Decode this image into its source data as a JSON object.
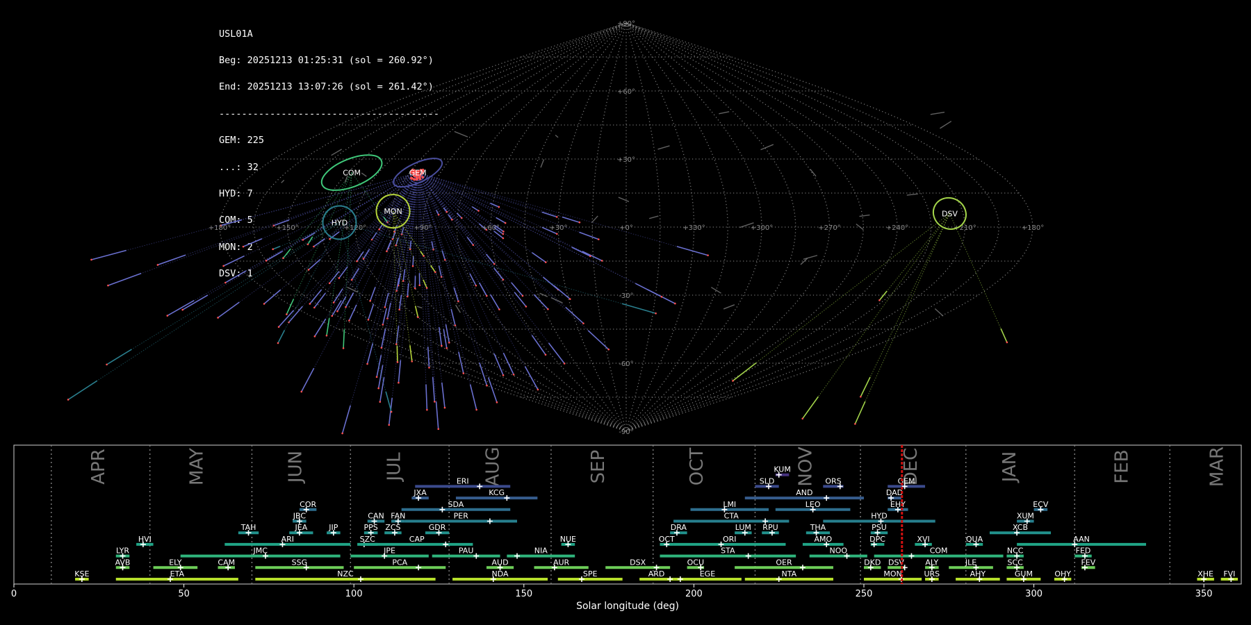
{
  "info_panel": {
    "station": "USL01A",
    "begin": "Beg: 20251213 01:25:31 (sol = 260.92°)",
    "end": "End: 20251213 13:07:26 (sol = 261.42°)",
    "separator": "---------------------------------------",
    "counts": [
      {
        "code": "GEM",
        "text": "GEM: 225"
      },
      {
        "code": "...",
        "text": "...: 32"
      },
      {
        "code": "HYD",
        "text": "HYD: 7"
      },
      {
        "code": "COM",
        "text": "COM: 5"
      },
      {
        "code": "MON",
        "text": "MON: 2"
      },
      {
        "code": "DSV",
        "text": "DSV: 1"
      }
    ]
  },
  "chart_data": [
    {
      "type": "scatter",
      "projection": "sinusoidal (all-sky, ecliptic)",
      "lon_tick_labels": [
        "+180°",
        "+150°",
        "+120°",
        "+90°",
        "+60°",
        "+30°",
        "+0°",
        "+330°",
        "+300°",
        "+270°",
        "+240°",
        "+210°",
        "+180°"
      ],
      "lat_tick_labels": [
        "+90°",
        "+60°",
        "+30°",
        "-30°",
        "-60°",
        "-90°"
      ],
      "grid": true,
      "colors": {
        "background": "#000000",
        "grid": "#8a8a8a",
        "trail": "#4b4ea0",
        "dot": "#ff5050"
      },
      "shower_radiants": [
        {
          "code": "COM",
          "lon": 133,
          "lat": 24,
          "ring_color": "#3fc87a",
          "count": 5
        },
        {
          "code": "GEM",
          "lon": 101,
          "lat": 24,
          "ring_color": "#4a4e9e",
          "count": 225
        },
        {
          "code": "HYD",
          "lon": 127,
          "lat": 2,
          "ring_color": "#2a7f8e",
          "count": 7
        },
        {
          "code": "MON",
          "lon": 104,
          "lat": 7,
          "ring_color": "#b5d43a",
          "count": 2
        },
        {
          "code": "DSV",
          "lon": 216,
          "lat": 6,
          "ring_color": "#a3d44a",
          "count": 1
        }
      ]
    },
    {
      "type": "bar",
      "xlabel": "Solar longitude (deg)",
      "xlim": [
        0,
        361
      ],
      "x_ticks": [
        0,
        50,
        100,
        150,
        200,
        250,
        300,
        350
      ],
      "current_sol": 261.2,
      "months": [
        {
          "label": "APR",
          "boundary": 11,
          "center": 25
        },
        {
          "label": "MAY",
          "boundary": 40,
          "center": 54
        },
        {
          "label": "JUN",
          "boundary": 70,
          "center": 83
        },
        {
          "label": "JUL",
          "boundary": 99,
          "center": 112
        },
        {
          "label": "AUG",
          "boundary": 128,
          "center": 141
        },
        {
          "label": "SEP",
          "boundary": 158,
          "center": 172
        },
        {
          "label": "OCT",
          "boundary": 188,
          "center": 201
        },
        {
          "label": "NOV",
          "boundary": 218,
          "center": 233
        },
        {
          "label": "DEC",
          "boundary": 249,
          "center": 264
        },
        {
          "label": "JAN",
          "boundary": 280,
          "center": 293
        },
        {
          "label": "FEB",
          "boundary": 312,
          "center": 326
        },
        {
          "label": "MAR",
          "boundary": 340,
          "center": 354
        }
      ],
      "showers": [
        {
          "code": "KUM",
          "start": 224,
          "end": 228,
          "peak": 225,
          "row": 10,
          "color": "#46327e"
        },
        {
          "code": "ERI",
          "start": 118,
          "end": 146,
          "peak": 137,
          "row": 9,
          "color": "#3b4a8c"
        },
        {
          "code": "SLD",
          "start": 218,
          "end": 225,
          "peak": 222,
          "row": 9,
          "color": "#3b4a8c"
        },
        {
          "code": "ORS",
          "start": 238,
          "end": 244,
          "peak": 243,
          "row": 9,
          "color": "#3b4a8c"
        },
        {
          "code": "GEM",
          "start": 257,
          "end": 268,
          "peak": 262,
          "row": 9,
          "color": "#3b4a8c"
        },
        {
          "code": "JXA",
          "start": 117,
          "end": 122,
          "peak": 119,
          "row": 8,
          "color": "#365c8d"
        },
        {
          "code": "KCG",
          "start": 130,
          "end": 154,
          "peak": 145,
          "row": 8,
          "color": "#365c8d"
        },
        {
          "code": "AND",
          "start": 215,
          "end": 250,
          "peak": 239,
          "row": 8,
          "color": "#365c8d"
        },
        {
          "code": "DAD",
          "start": 257,
          "end": 261,
          "peak": 258,
          "row": 8,
          "color": "#365c8d"
        },
        {
          "code": "COR",
          "start": 84,
          "end": 89,
          "peak": 86,
          "row": 7,
          "color": "#2e6e8e"
        },
        {
          "code": "SDA",
          "start": 114,
          "end": 146,
          "peak": 126,
          "row": 7,
          "color": "#2e6e8e"
        },
        {
          "code": "LMI",
          "start": 199,
          "end": 222,
          "peak": 209,
          "row": 7,
          "color": "#2e6e8e"
        },
        {
          "code": "LEO",
          "start": 224,
          "end": 246,
          "peak": 235,
          "row": 7,
          "color": "#2e6e8e"
        },
        {
          "code": "EHY",
          "start": 257,
          "end": 263,
          "peak": 260,
          "row": 7,
          "color": "#2e6e8e"
        },
        {
          "code": "ECV",
          "start": 300,
          "end": 304,
          "peak": 302,
          "row": 7,
          "color": "#2e6e8e"
        },
        {
          "code": "JBC",
          "start": 82,
          "end": 86,
          "peak": 84,
          "row": 6,
          "color": "#277f8e"
        },
        {
          "code": "CAN",
          "start": 104,
          "end": 109,
          "peak": 106,
          "row": 6,
          "color": "#277f8e"
        },
        {
          "code": "FAN",
          "start": 111,
          "end": 115,
          "peak": 113,
          "row": 6,
          "color": "#277f8e"
        },
        {
          "code": "PER",
          "start": 115,
          "end": 148,
          "peak": 140,
          "row": 6,
          "color": "#277f8e"
        },
        {
          "code": "CTA",
          "start": 194,
          "end": 228,
          "peak": 221,
          "row": 6,
          "color": "#277f8e"
        },
        {
          "code": "HYD",
          "start": 238,
          "end": 271,
          "peak": 255,
          "row": 6,
          "color": "#277f8e"
        },
        {
          "code": "XUM",
          "start": 295,
          "end": 300,
          "peak": 298,
          "row": 6,
          "color": "#277f8e"
        },
        {
          "code": "TAH",
          "start": 66,
          "end": 72,
          "peak": 69,
          "row": 5,
          "color": "#21918c"
        },
        {
          "code": "JEA",
          "start": 81,
          "end": 88,
          "peak": 84,
          "row": 5,
          "color": "#21918c"
        },
        {
          "code": "JIP",
          "start": 92,
          "end": 96,
          "peak": 94,
          "row": 5,
          "color": "#21918c"
        },
        {
          "code": "PPS",
          "start": 103,
          "end": 107,
          "peak": 105,
          "row": 5,
          "color": "#21918c"
        },
        {
          "code": "ZCS",
          "start": 109,
          "end": 114,
          "peak": 112,
          "row": 5,
          "color": "#21918c"
        },
        {
          "code": "GDR",
          "start": 121,
          "end": 128,
          "peak": 125,
          "row": 5,
          "color": "#21918c"
        },
        {
          "code": "DRA",
          "start": 193,
          "end": 198,
          "peak": 195,
          "row": 5,
          "color": "#21918c"
        },
        {
          "code": "LUM",
          "start": 212,
          "end": 217,
          "peak": 215,
          "row": 5,
          "color": "#21918c"
        },
        {
          "code": "RPU",
          "start": 220,
          "end": 225,
          "peak": 223,
          "row": 5,
          "color": "#21918c"
        },
        {
          "code": "THA",
          "start": 233,
          "end": 240,
          "peak": 236,
          "row": 5,
          "color": "#21918c"
        },
        {
          "code": "PSU",
          "start": 252,
          "end": 257,
          "peak": 254,
          "row": 5,
          "color": "#21918c"
        },
        {
          "code": "XCB",
          "start": 287,
          "end": 305,
          "peak": 295,
          "row": 5,
          "color": "#21918c"
        },
        {
          "code": "HVI",
          "start": 36,
          "end": 41,
          "peak": 38,
          "row": 4,
          "color": "#20a486"
        },
        {
          "code": "ARI",
          "start": 62,
          "end": 99,
          "peak": 79,
          "row": 4,
          "color": "#20a486"
        },
        {
          "code": "SZC",
          "start": 101,
          "end": 107,
          "peak": 103,
          "row": 4,
          "color": "#20a486"
        },
        {
          "code": "CAP",
          "start": 102,
          "end": 135,
          "peak": 127,
          "row": 4,
          "color": "#20a486"
        },
        {
          "code": "NUE",
          "start": 161,
          "end": 165,
          "peak": 163,
          "row": 4,
          "color": "#20a486"
        },
        {
          "code": "OCT",
          "start": 190,
          "end": 194,
          "peak": 192,
          "row": 4,
          "color": "#20a486"
        },
        {
          "code": "ORI",
          "start": 194,
          "end": 227,
          "peak": 208,
          "row": 4,
          "color": "#20a486"
        },
        {
          "code": "AMO",
          "start": 232,
          "end": 244,
          "peak": 239,
          "row": 4,
          "color": "#20a486"
        },
        {
          "code": "DPC",
          "start": 252,
          "end": 256,
          "peak": 253,
          "row": 4,
          "color": "#20a486"
        },
        {
          "code": "XVI",
          "start": 265,
          "end": 270,
          "peak": 268,
          "row": 4,
          "color": "#20a486"
        },
        {
          "code": "QUA",
          "start": 280,
          "end": 285,
          "peak": 283,
          "row": 4,
          "color": "#20a486"
        },
        {
          "code": "AAN",
          "start": 295,
          "end": 333,
          "peak": 312,
          "row": 4,
          "color": "#20a486"
        },
        {
          "code": "LYR",
          "start": 30,
          "end": 34,
          "peak": 32,
          "row": 3,
          "color": "#2fb47c"
        },
        {
          "code": "JMC",
          "start": 49,
          "end": 96,
          "peak": 74,
          "row": 3,
          "color": "#2fb47c"
        },
        {
          "code": "JPE",
          "start": 99,
          "end": 122,
          "peak": 109,
          "row": 3,
          "color": "#2fb47c"
        },
        {
          "code": "PAU",
          "start": 123,
          "end": 143,
          "peak": 136,
          "row": 3,
          "color": "#2fb47c"
        },
        {
          "code": "NIA",
          "start": 145,
          "end": 165,
          "peak": 148,
          "row": 3,
          "color": "#2fb47c"
        },
        {
          "code": "STA",
          "start": 190,
          "end": 230,
          "peak": 216,
          "row": 3,
          "color": "#2fb47c"
        },
        {
          "code": "NOO",
          "start": 234,
          "end": 251,
          "peak": 245,
          "row": 3,
          "color": "#2fb47c"
        },
        {
          "code": "COM",
          "start": 253,
          "end": 291,
          "peak": 264,
          "row": 3,
          "color": "#2fb47c"
        },
        {
          "code": "NCC",
          "start": 292,
          "end": 297,
          "peak": 295,
          "row": 3,
          "color": "#2fb47c"
        },
        {
          "code": "FED",
          "start": 312,
          "end": 317,
          "peak": 315,
          "row": 3,
          "color": "#2fb47c"
        },
        {
          "code": "AVB",
          "start": 30,
          "end": 34,
          "peak": 32,
          "row": 2,
          "color": "#6ece58"
        },
        {
          "code": "ELY",
          "start": 41,
          "end": 54,
          "peak": 49,
          "row": 2,
          "color": "#6ece58"
        },
        {
          "code": "CAM",
          "start": 60,
          "end": 65,
          "peak": 63,
          "row": 2,
          "color": "#6ece58"
        },
        {
          "code": "SSG",
          "start": 71,
          "end": 97,
          "peak": 86,
          "row": 2,
          "color": "#6ece58"
        },
        {
          "code": "PCA",
          "start": 100,
          "end": 127,
          "peak": 119,
          "row": 2,
          "color": "#6ece58"
        },
        {
          "code": "AUD",
          "start": 139,
          "end": 147,
          "peak": 143,
          "row": 2,
          "color": "#6ece58"
        },
        {
          "code": "AUR",
          "start": 153,
          "end": 169,
          "peak": 159,
          "row": 2,
          "color": "#6ece58"
        },
        {
          "code": "DSX",
          "start": 174,
          "end": 193,
          "peak": 189,
          "row": 2,
          "color": "#6ece58"
        },
        {
          "code": "OCU",
          "start": 198,
          "end": 203,
          "peak": 202,
          "row": 2,
          "color": "#6ece58"
        },
        {
          "code": "OER",
          "start": 212,
          "end": 241,
          "peak": 232,
          "row": 2,
          "color": "#6ece58"
        },
        {
          "code": "DKD",
          "start": 250,
          "end": 255,
          "peak": 252,
          "row": 2,
          "color": "#6ece58"
        },
        {
          "code": "DSV",
          "start": 257,
          "end": 262,
          "peak": 262,
          "row": 2,
          "color": "#6ece58"
        },
        {
          "code": "ALY",
          "start": 268,
          "end": 272,
          "peak": 270,
          "row": 2,
          "color": "#6ece58"
        },
        {
          "code": "JLE",
          "start": 275,
          "end": 288,
          "peak": 283,
          "row": 2,
          "color": "#6ece58"
        },
        {
          "code": "SCC",
          "start": 292,
          "end": 297,
          "peak": 295,
          "row": 2,
          "color": "#6ece58"
        },
        {
          "code": "FEV",
          "start": 314,
          "end": 318,
          "peak": 315,
          "row": 2,
          "color": "#6ece58"
        },
        {
          "code": "KSE",
          "start": 18,
          "end": 22,
          "peak": 20,
          "row": 1,
          "color": "#b5de2b"
        },
        {
          "code": "ETA",
          "start": 30,
          "end": 66,
          "peak": 46,
          "row": 1,
          "color": "#b5de2b"
        },
        {
          "code": "NZC",
          "start": 71,
          "end": 124,
          "peak": 102,
          "row": 1,
          "color": "#b5de2b"
        },
        {
          "code": "NDA",
          "start": 129,
          "end": 157,
          "peak": 141,
          "row": 1,
          "color": "#b5de2b"
        },
        {
          "code": "SPE",
          "start": 160,
          "end": 179,
          "peak": 167,
          "row": 1,
          "color": "#b5de2b"
        },
        {
          "code": "ARD",
          "start": 184,
          "end": 194,
          "peak": 193,
          "row": 1,
          "color": "#b5de2b"
        },
        {
          "code": "EGE",
          "start": 194,
          "end": 214,
          "peak": 196,
          "row": 1,
          "color": "#b5de2b"
        },
        {
          "code": "NTA",
          "start": 215,
          "end": 241,
          "peak": 225,
          "row": 1,
          "color": "#b5de2b"
        },
        {
          "code": "MON",
          "start": 250,
          "end": 267,
          "peak": 261,
          "row": 1,
          "color": "#b5de2b"
        },
        {
          "code": "URS",
          "start": 268,
          "end": 272,
          "peak": 270,
          "row": 1,
          "color": "#b5de2b"
        },
        {
          "code": "AHY",
          "start": 277,
          "end": 290,
          "peak": 284,
          "row": 1,
          "color": "#b5de2b"
        },
        {
          "code": "GUM",
          "start": 292,
          "end": 302,
          "peak": 297,
          "row": 1,
          "color": "#b5de2b"
        },
        {
          "code": "OHY",
          "start": 306,
          "end": 311,
          "peak": 309,
          "row": 1,
          "color": "#b5de2b"
        },
        {
          "code": "XHE",
          "start": 348,
          "end": 353,
          "peak": 350,
          "row": 1,
          "color": "#b5de2b"
        },
        {
          "code": "FVI",
          "start": 355,
          "end": 360,
          "peak": 358,
          "row": 1,
          "color": "#b5de2b"
        }
      ]
    }
  ]
}
